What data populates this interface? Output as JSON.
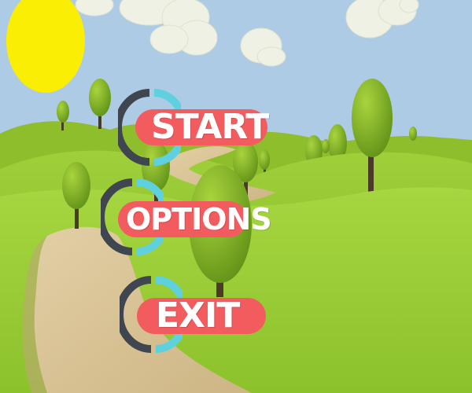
{
  "menu": {
    "start_label": "START",
    "options_label": "OPTIONS",
    "exit_label": "EXIT"
  },
  "icons": [
    "sun-icon",
    "cloud-icon",
    "tree-icon",
    "ring-icon"
  ],
  "colors": {
    "sky": "#aecbe6",
    "sun": "#fbee05",
    "grass_light": "#a4d33b",
    "grass_dark": "#6b9e1e",
    "path": "#dcc69a",
    "button_pill": "#f25c5e",
    "ring_dark": "#3f4650",
    "ring_cyan": "#5fd0de",
    "label": "#ffffff"
  }
}
